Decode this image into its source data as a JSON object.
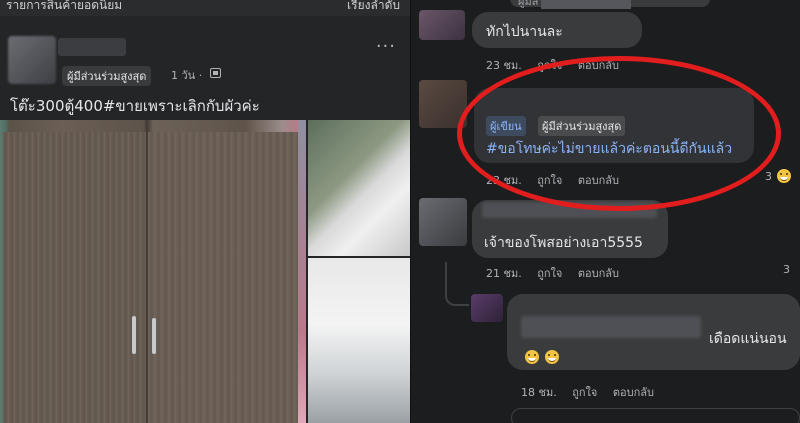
{
  "left": {
    "header_title": "รายการสินค้ายอดนิยม",
    "header_sort": "เรียงลำดับ",
    "badge": "ผู้มีส่วนร่วมสูงสุด",
    "time": "1 วัน ·",
    "post_text": "โต๊ะ300ตู้400#ขายเพราะเลิกกับผัวค่ะ"
  },
  "right": {
    "top_badge": "ผู้มีส่วนร่วมสูงสุด",
    "comments": [
      {
        "text": "ทักไปนานละ",
        "time": "23 ชม.",
        "like": "ถูกใจ",
        "reply": "ตอบกลับ"
      },
      {
        "tag_author": "ผู้เขียน",
        "tag_top": "ผู้มีส่วนร่วมสูงสุด",
        "text": "#ขอโทษค่ะไม่ขายแล้วค่ะตอนนี้ดีกันแล้ว",
        "time": "23 ชม.",
        "like": "ถูกใจ",
        "reply": "ตอบกลับ",
        "reaction_count": "3"
      },
      {
        "text": "เจ้าของโพสอย่างเอา5555",
        "time": "21 ชม.",
        "like": "ถูกใจ",
        "reply": "ตอบกลับ",
        "reaction_count": "3"
      },
      {
        "text": "เดือดแน่นอน",
        "time": "18 ชม.",
        "like": "ถูกใจ",
        "reply": "ตอบกลับ"
      }
    ]
  },
  "colors": {
    "highlight": "#e11d1d",
    "link": "#8ab4f8",
    "bubble": "#3a3b3c"
  }
}
